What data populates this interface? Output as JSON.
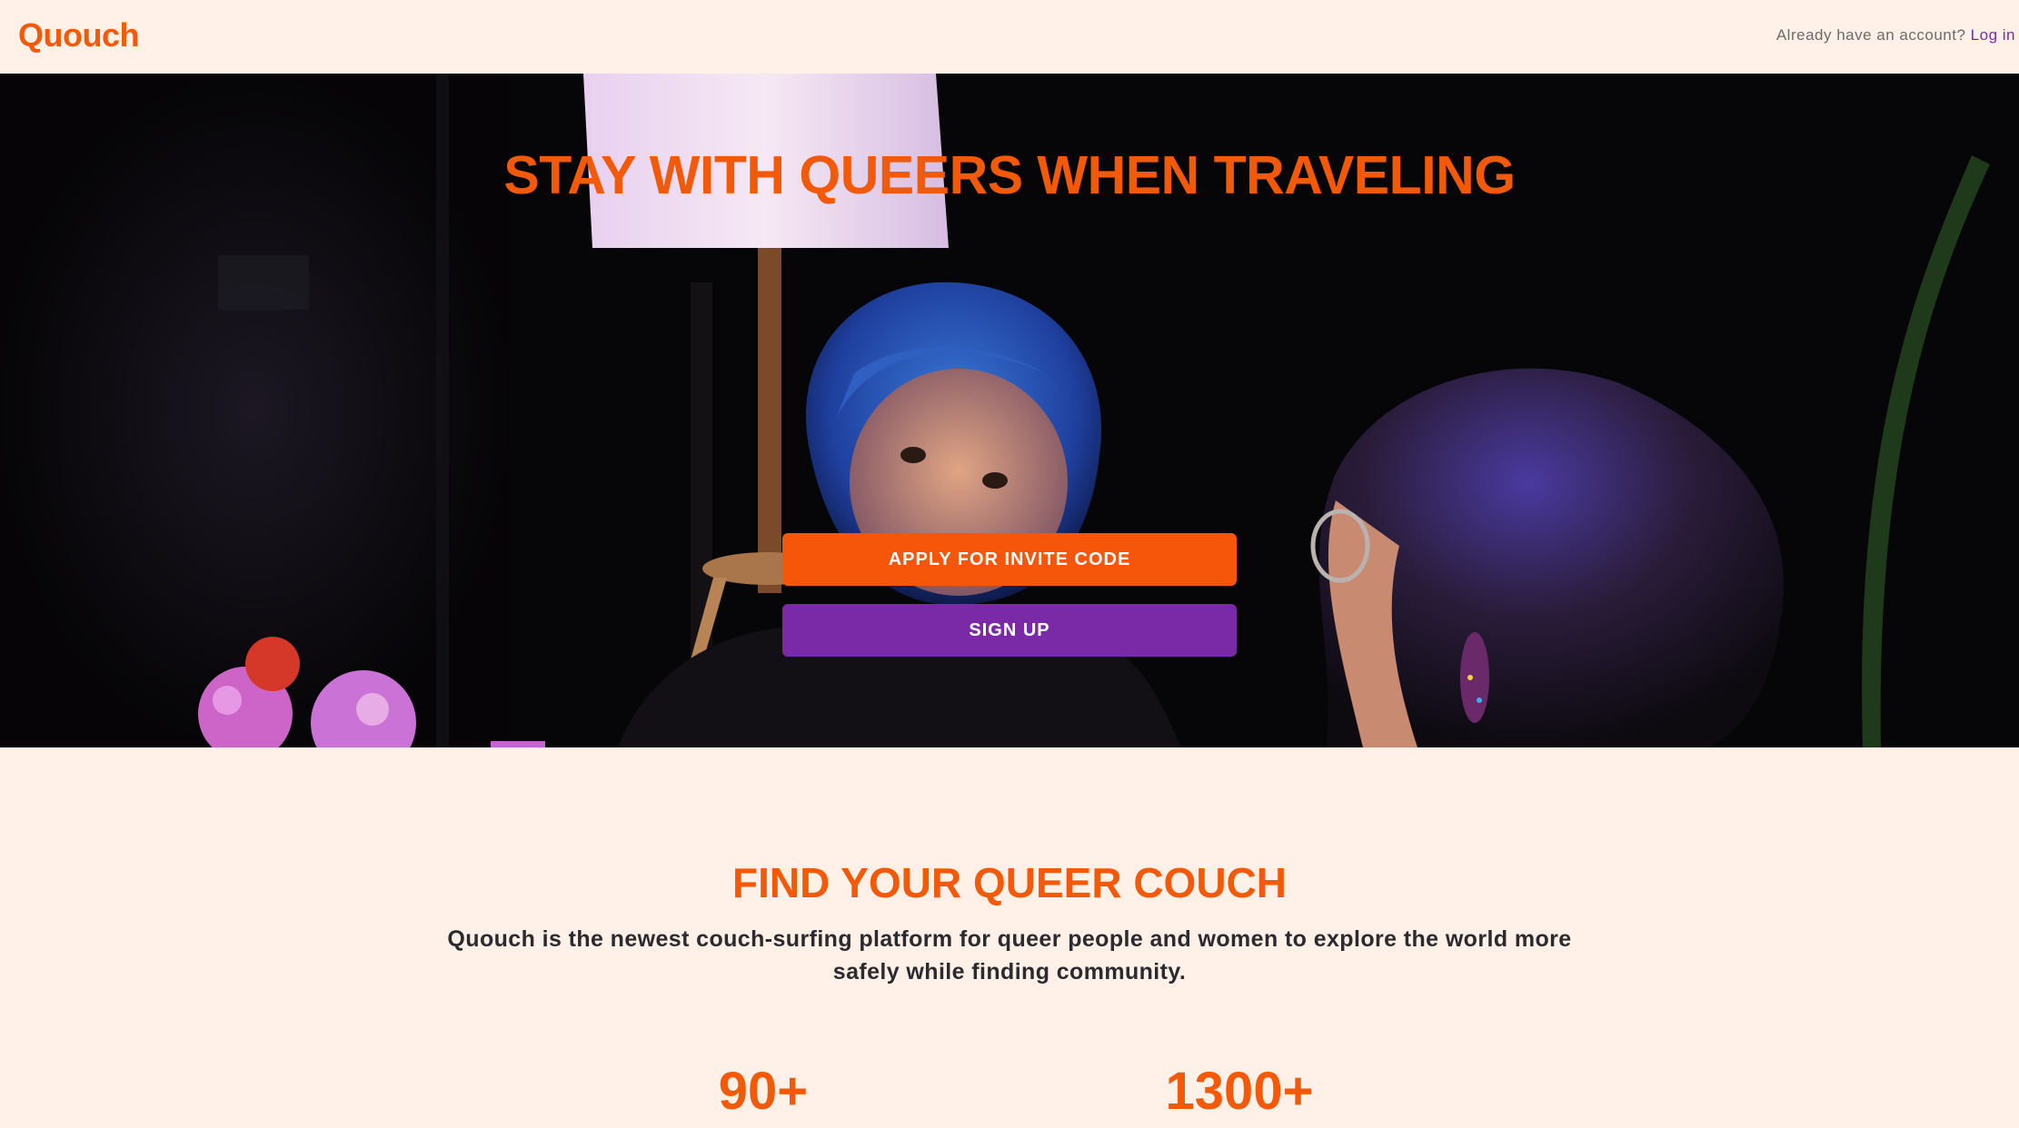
{
  "header": {
    "logo": "Quouch",
    "login_prompt": "Already have an account?",
    "login_link": "Log in"
  },
  "hero": {
    "title": "STAY WITH QUEERS WHEN TRAVELING",
    "apply_button": "APPLY FOR INVITE CODE",
    "signup_button": "SIGN UP"
  },
  "about": {
    "title": "FIND YOUR QUEER COUCH",
    "description": "Quouch is the newest couch-surfing platform for queer people and women to explore the world more safely while finding community."
  },
  "stats": [
    {
      "value": "90+"
    },
    {
      "value": "1300+"
    }
  ],
  "colors": {
    "brand_orange": "#f25a0a",
    "brand_purple": "#7a2aa6",
    "background": "#fff0e8"
  }
}
